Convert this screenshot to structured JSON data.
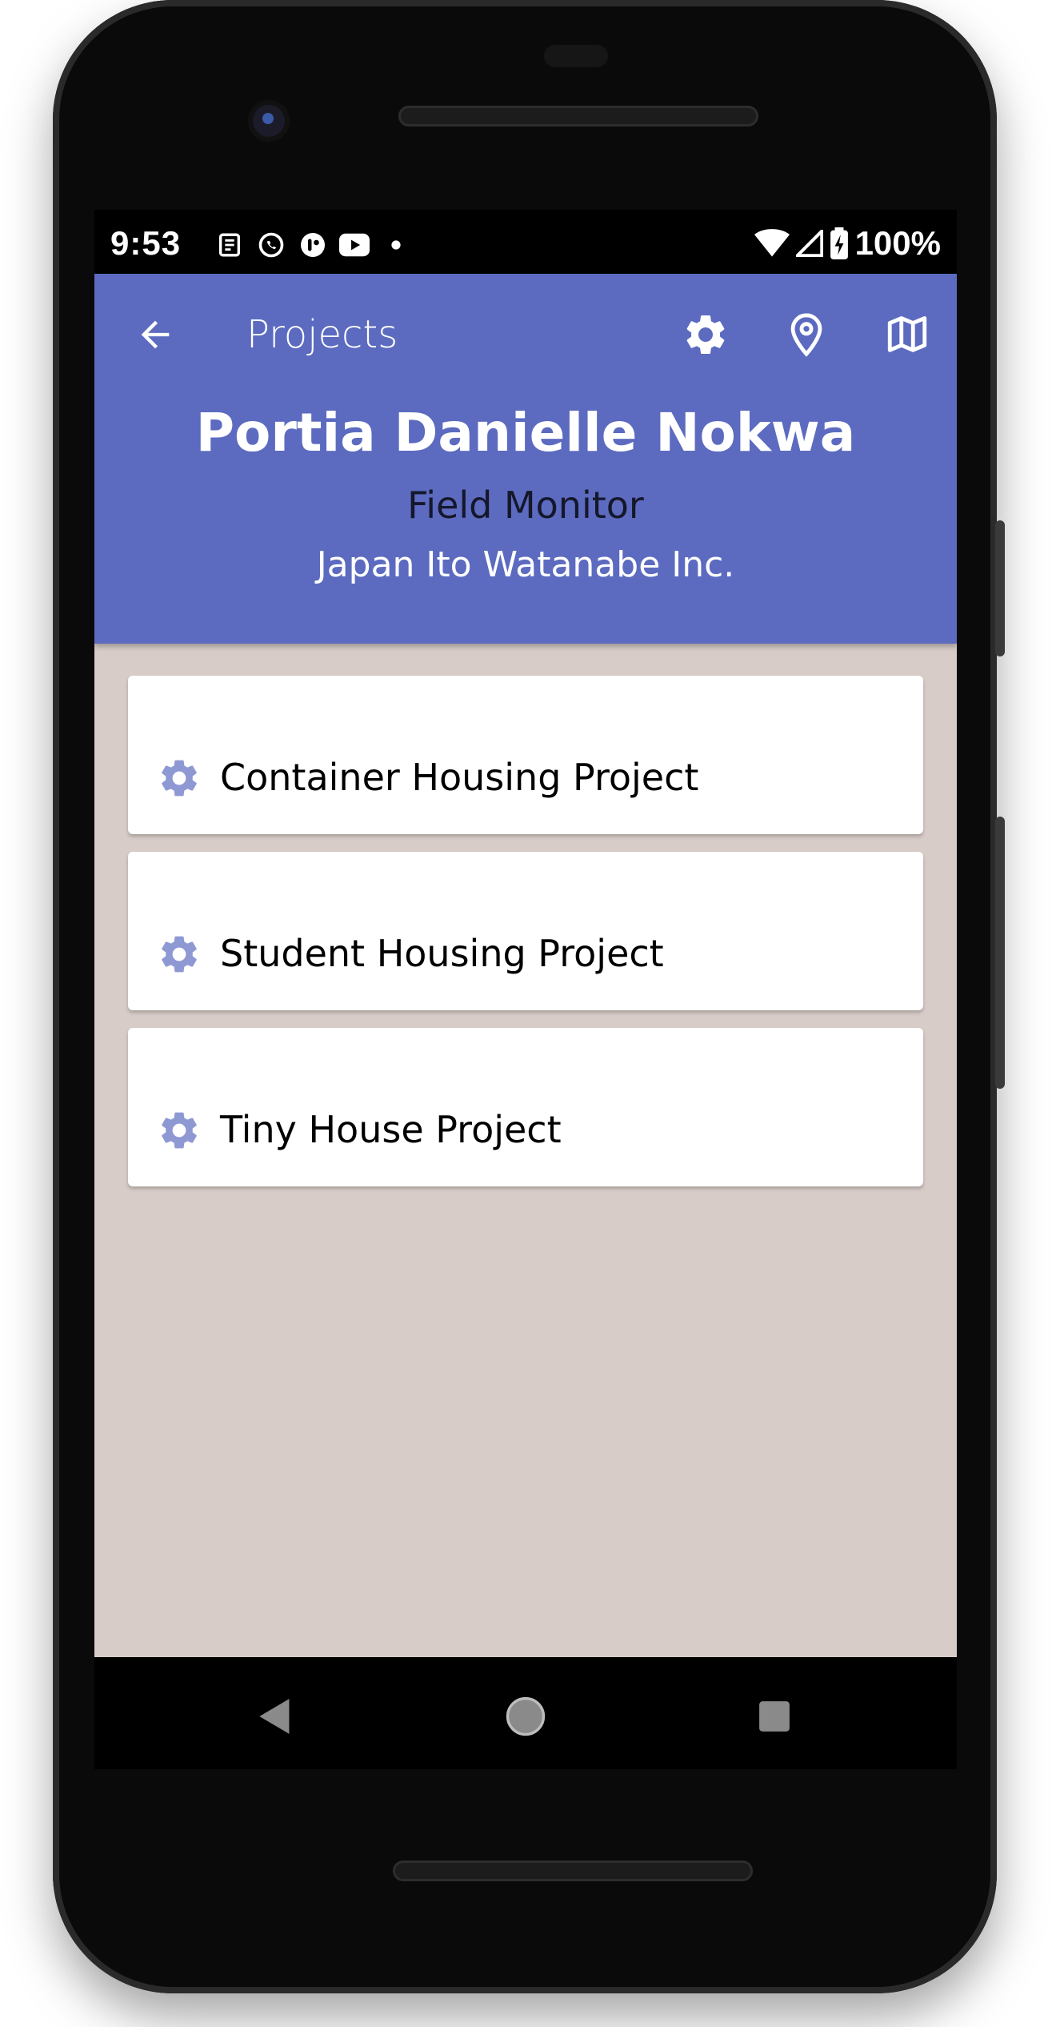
{
  "status_bar": {
    "time": "9:53",
    "battery": "100%",
    "left_icons": [
      "news-icon",
      "whatsapp-icon",
      "app-icon",
      "youtube-icon",
      "dot-icon"
    ],
    "right_icons": [
      "wifi-icon",
      "signal-icon",
      "battery-icon"
    ]
  },
  "toolbar": {
    "title": "Projects",
    "actions": [
      "settings-icon",
      "location-pin-icon",
      "map-icon"
    ]
  },
  "profile": {
    "name": "Portia Danielle Nokwa",
    "role": "Field Monitor",
    "organization": "Japan Ito Watanabe Inc."
  },
  "projects": [
    {
      "label": "Container Housing Project",
      "icon": "gear-icon"
    },
    {
      "label": "Student Housing Project",
      "icon": "gear-icon"
    },
    {
      "label": "Tiny House Project",
      "icon": "gear-icon"
    }
  ],
  "colors": {
    "primary": "#5c6bc0",
    "background": "#d7ccc8",
    "card": "#ffffff",
    "icon_tint": "#8e99d4"
  }
}
